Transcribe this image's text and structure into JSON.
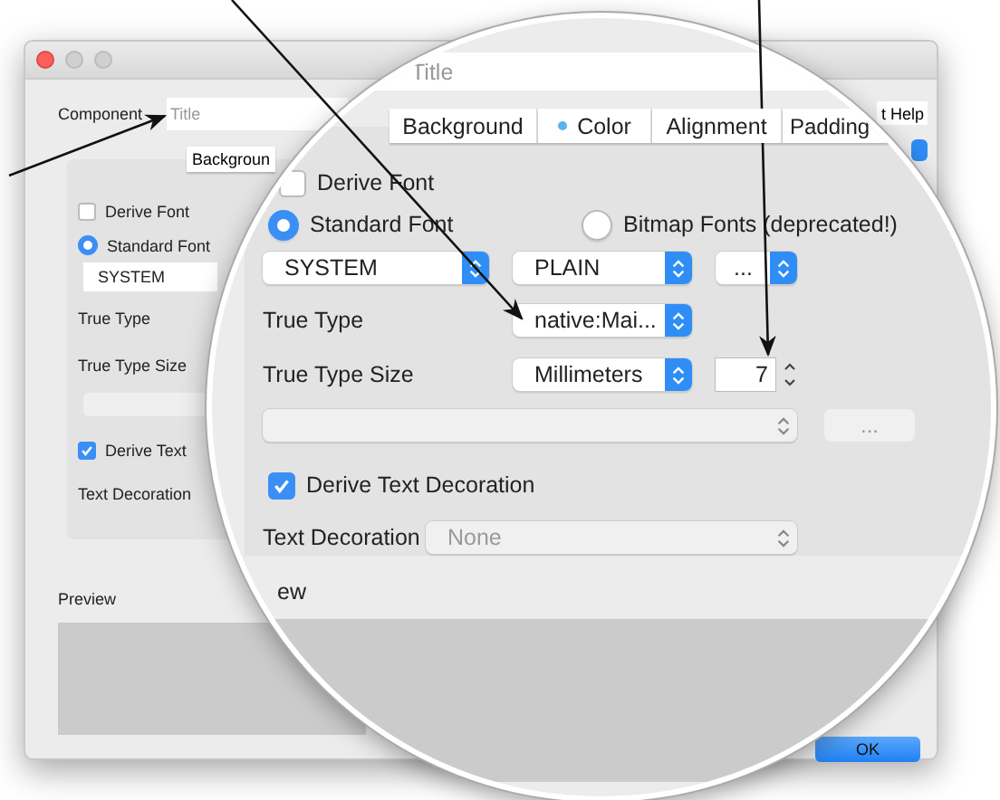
{
  "window": {
    "component_label": "Component",
    "title_placeholder": "Title",
    "tab_button": "Backgroun",
    "help_button": "t Help",
    "ok_button": "OK",
    "derive_font": {
      "label": "Derive Font",
      "checked": false
    },
    "standard_font": {
      "label": "Standard Font",
      "selected": true
    },
    "font_dropdown": "SYSTEM",
    "true_type_label": "True Type",
    "true_type_size_label": "True Type Size",
    "derive_text": {
      "label": "Derive Text",
      "checked": true
    },
    "text_decoration_label": "Text Decoration",
    "preview_label": "Preview"
  },
  "magnifier": {
    "title_placeholder": "Title",
    "tabs": [
      {
        "label": "Background",
        "marked": false
      },
      {
        "label": "Color",
        "marked": true
      },
      {
        "label": "Alignment",
        "marked": false
      },
      {
        "label": "Padding",
        "marked": false
      }
    ],
    "derive_font": {
      "label": "Derive Font",
      "checked": false
    },
    "font_sources": [
      {
        "label": "Standard Font",
        "selected": true
      },
      {
        "label": "Bitmap Fonts (deprecated!)",
        "selected": false
      }
    ],
    "font_name": "SYSTEM",
    "font_style": "PLAIN",
    "more": "...",
    "true_type": {
      "label": "True Type",
      "value": "native:Mai..."
    },
    "size": {
      "label": "True Type Size",
      "unit": "Millimeters",
      "value": "7"
    },
    "bitmap": {
      "button": "...",
      "disabled": true
    },
    "derive_text_decoration": {
      "label": "Derive Text Decoration",
      "checked": true
    },
    "text_decoration": {
      "label": "Text Decoration",
      "value": "None",
      "disabled": true
    },
    "preview_label": "ew"
  }
}
